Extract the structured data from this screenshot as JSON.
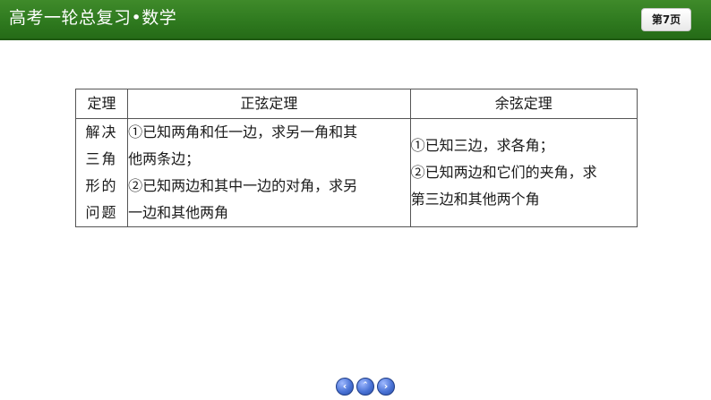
{
  "header": {
    "title": "高考一轮总复习•数学",
    "page_label": "第7页"
  },
  "table": {
    "headers": [
      "定理",
      "正弦定理",
      "余弦定理"
    ],
    "row": {
      "label_lines": [
        "解决",
        "三角",
        "形的",
        "问题"
      ],
      "sine_lines": [
        "①已知两角和任一边，求另一角和其",
        "他两条边；",
        "②已知两边和其中一边的对角，求另",
        "一边和其他两角"
      ],
      "cosine_lines": [
        "①已知三边，求各角；",
        "②已知两边和它们的夹角，求",
        "第三边和其他两个角"
      ]
    }
  },
  "nav": {
    "prev_icon": "chevron-left-icon",
    "up_icon": "chevron-up-icon",
    "next_icon": "chevron-right-icon",
    "prev_glyph": "‹",
    "up_glyph": "ˆ",
    "next_glyph": "›"
  },
  "colors": {
    "header_green": "#2f7a1f",
    "nav_blue": "#4a73d6"
  }
}
